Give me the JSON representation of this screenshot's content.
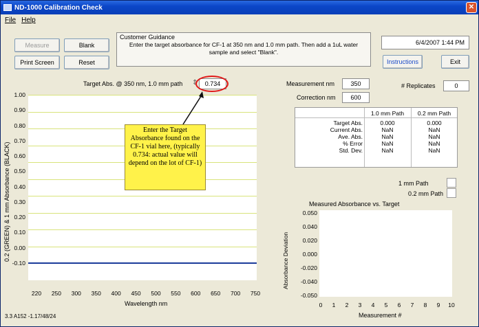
{
  "window": {
    "title": "ND-1000 Calibration Check",
    "close_glyph": "✕"
  },
  "menu": {
    "file": "File",
    "help": "Help"
  },
  "buttons": {
    "measure": "Measure",
    "blank": "Blank",
    "print_screen": "Print Screen",
    "reset": "Reset",
    "instructions": "Instructions",
    "exit": "Exit"
  },
  "guidance": {
    "label": "Customer Guidance",
    "text": "Enter the target absorbance for CF-1 at 350 nm and 1.0 mm path.  Then add a 1uL water sample and select \"Blank\"."
  },
  "datetime": "6/4/2007 1:44 PM",
  "target_abs": {
    "label": "Target Abs. @ 350 nm, 1.0 mm path",
    "value": "0.734"
  },
  "measurement_nm": {
    "label": "Measurement nm",
    "value": "350"
  },
  "correction_nm": {
    "label": "Correction nm",
    "value": "600"
  },
  "replicates": {
    "label": "# Replicates",
    "value": "0"
  },
  "table": {
    "headers": [
      "1.0 mm Path",
      "0.2 mm Path"
    ],
    "rows": [
      {
        "label": "Target Abs.",
        "a": "0.000",
        "b": "0.000"
      },
      {
        "label": "Current Abs.",
        "a": "NaN",
        "b": "NaN"
      },
      {
        "label": "Ave. Abs.",
        "a": "NaN",
        "b": "NaN"
      },
      {
        "label": "% Error",
        "a": "NaN",
        "b": "NaN"
      },
      {
        "label": "Std. Dev.",
        "a": "NaN",
        "b": "NaN"
      }
    ]
  },
  "legend": {
    "path1": "1 mm Path",
    "path2": "0.2 mm Path"
  },
  "callout": "Enter the Target Absorbance found on the CF-1 vial here, (typically 0.734: actual value will depend on the lot of CF-1)",
  "version": "3.3 A152 -1.17/48/24",
  "colors": {
    "accent": "#1a4ac8",
    "grid": "#d8e37a",
    "callout": "#fff24a",
    "highlight": "#e01818"
  },
  "chart_data": [
    {
      "type": "line",
      "xlabel": "Wavelength nm",
      "ylabel": "0.2 (GREEN) & 1 mm Absorbance (BLACK)",
      "x_ticks": [
        "220",
        "250",
        "300",
        "350",
        "400",
        "450",
        "500",
        "550",
        "600",
        "650",
        "700",
        "750"
      ],
      "y_ticks": [
        "1.00",
        "0.90",
        "0.80",
        "0.70",
        "0.60",
        "0.50",
        "0.40",
        "0.30",
        "0.20",
        "0.10",
        "0.00",
        "-0.10"
      ],
      "xlim": [
        220,
        750
      ],
      "ylim": [
        -0.1,
        1.0
      ],
      "grid": true,
      "series": [
        {
          "x": [
            220,
            750
          ],
          "y": [
            0.0,
            0.0
          ],
          "color": "#1a3a9a"
        }
      ]
    },
    {
      "type": "scatter",
      "title": "Measured Absorbance vs. Target",
      "xlabel": "Measurement #",
      "ylabel": "Absorbance Deviation",
      "x_ticks": [
        "0",
        "1",
        "2",
        "3",
        "4",
        "5",
        "6",
        "7",
        "8",
        "9",
        "10"
      ],
      "y_ticks": [
        "0.050",
        "0.040",
        "0.020",
        "0.000",
        "-0.020",
        "-0.040",
        "-0.050"
      ],
      "xlim": [
        0,
        10
      ],
      "ylim": [
        -0.05,
        0.05
      ],
      "series": []
    }
  ]
}
